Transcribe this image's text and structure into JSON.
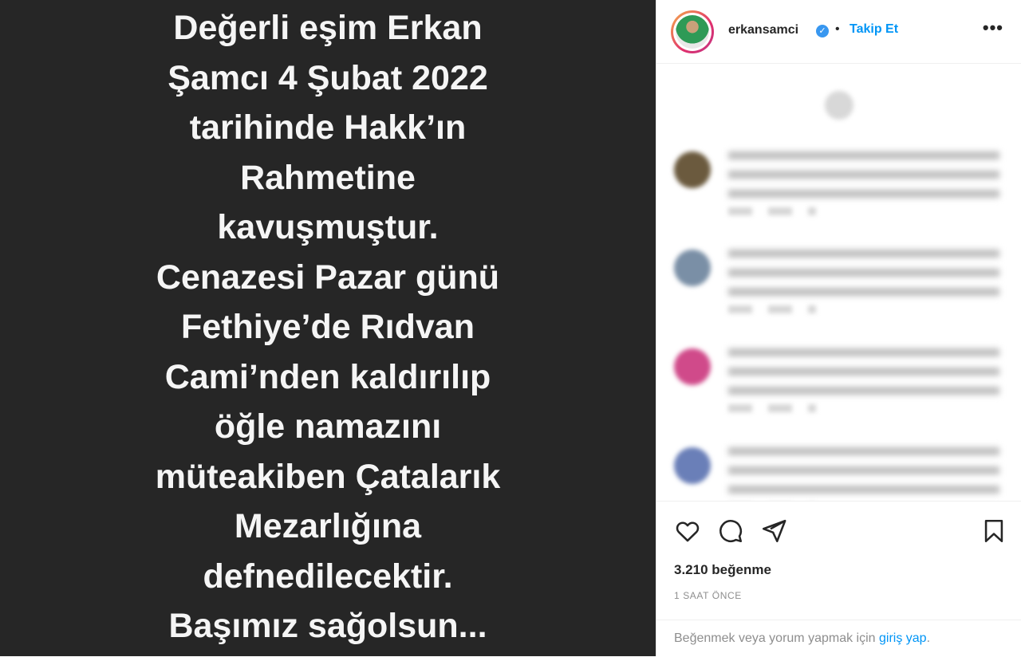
{
  "post": {
    "lines": [
      "Değerli eşim Erkan",
      "Şamcı 4 Şubat 2022",
      "tarihinde Hakk’ın",
      "Rahmetine",
      "kavuşmuştur.",
      "Cenazesi Pazar günü",
      "Fethiye’de Rıdvan",
      "Cami’nden kaldırılıp",
      "öğle namazını",
      "müteakiben Çatalarık",
      "Mezarlığına",
      "defnedilecektir.",
      "Başımız sağolsun..."
    ]
  },
  "header": {
    "username": "erkansamci",
    "verified_glyph": "✓",
    "separator": "•",
    "follow_label": "Takip Et",
    "more_glyph": "•••"
  },
  "comments": [
    {
      "avatar_color": "#6b5a3e",
      "text": "",
      "meta": ""
    },
    {
      "avatar_color": "#7a8fa6",
      "text": "",
      "meta": ""
    },
    {
      "avatar_color": "#d04a8a",
      "text": "",
      "meta": ""
    },
    {
      "avatar_color": "#6a7fb8",
      "text": "",
      "meta": ""
    }
  ],
  "actions": {
    "icons": [
      "heart-icon",
      "comment-icon",
      "share-icon",
      "bookmark-icon"
    ],
    "likes": "3.210 beğenme",
    "time": "1 SAAT ÖNCE"
  },
  "login": {
    "prefix": "Beğenmek veya yorum yapmak için ",
    "link": "giriş yap",
    "suffix": "."
  },
  "colors": {
    "image_bg": "#262626",
    "accent": "#0095f6",
    "verified": "#3897f0"
  }
}
